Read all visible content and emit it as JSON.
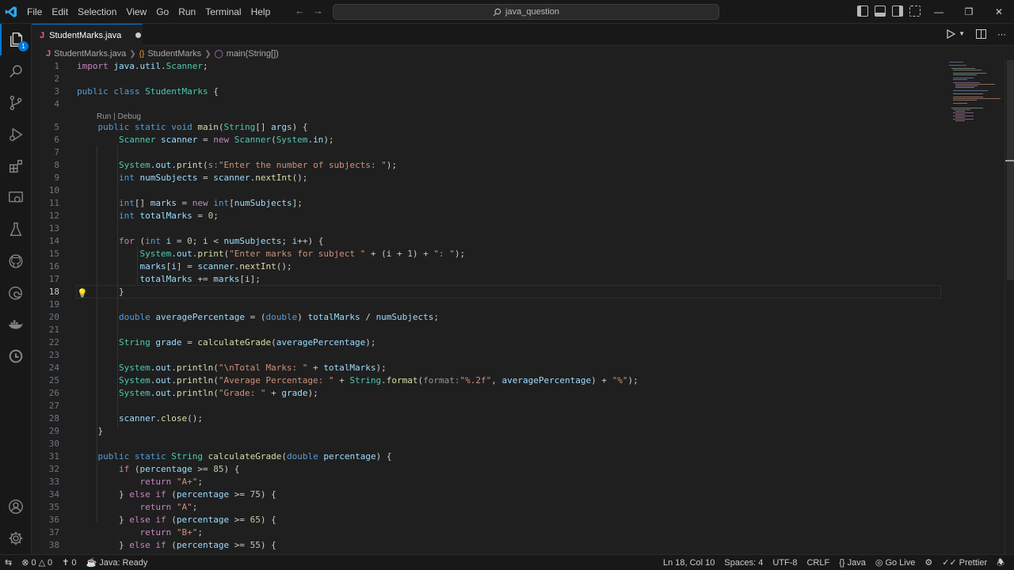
{
  "menu": [
    "File",
    "Edit",
    "Selection",
    "View",
    "Go",
    "Run",
    "Terminal",
    "Help"
  ],
  "search": {
    "text": "java_question"
  },
  "tab": {
    "icon": "J",
    "label": "StudentMarks.java"
  },
  "breadcrumb": {
    "file": "StudentMarks.java",
    "class": "StudentMarks",
    "method": "main(String[])"
  },
  "codelens": "Run | Debug",
  "explorer_badge": "1",
  "current_line": 18,
  "status": {
    "errors": "0",
    "warnings": "0",
    "ports": "0",
    "java": "Java: Ready",
    "position": "Ln 18, Col 10",
    "spaces": "Spaces: 4",
    "encoding": "UTF-8",
    "eol": "CRLF",
    "language": "Java",
    "golive": "Go Live",
    "prettier": "Prettier"
  },
  "colors": {
    "accent": "#0078d4",
    "background": "#1f1f1f",
    "sidebar": "#181818"
  },
  "icons": [
    "vscode-logo-icon",
    "files-icon",
    "search-icon",
    "source-control-icon",
    "run-debug-icon",
    "extensions-icon",
    "remote-explorer-icon",
    "testing-icon",
    "github-icon",
    "edge-icon",
    "docker-icon",
    "gitlens-icon",
    "account-icon",
    "settings-gear-icon"
  ]
}
